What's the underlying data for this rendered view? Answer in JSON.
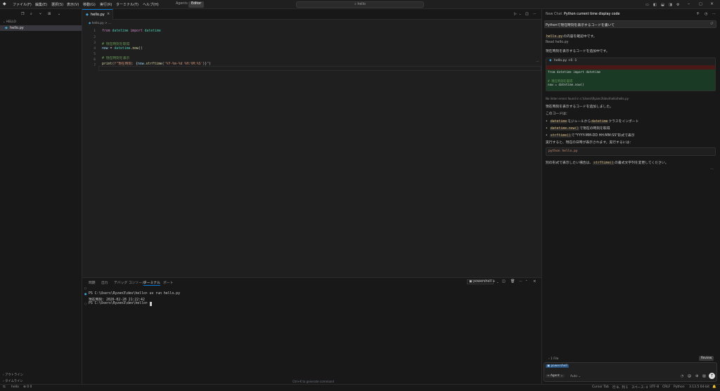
{
  "menu": [
    "ファイル(F)",
    "編集(E)",
    "選択(S)",
    "表示(V)",
    "移動(G)",
    "実行(R)",
    "ターミナル(T)",
    "ヘルプ(H)"
  ],
  "mode_tabs": {
    "agents": "Agents",
    "editor": "Editor"
  },
  "search": {
    "text": "hello"
  },
  "explorer": {
    "folder": "HELLO",
    "file": "hello.py",
    "outline": "アウトライン",
    "timeline": "タイムライン"
  },
  "editor": {
    "tab_label": "hello.py",
    "breadcrumb": "hello.py > ...",
    "line_numbers": [
      "1",
      "2",
      "3",
      "4",
      "5",
      "6",
      "7"
    ]
  },
  "panel": {
    "tabs": [
      "問題",
      "出力",
      "デバッグ コンソール",
      "ターミナル",
      "ポート"
    ],
    "shell": "powershell",
    "lines": [
      "PS C:\\Users\\Ryzen3\\dev\\hello> uv run hello.py",
      "現在時刻: 2026-02-28 21:22:42",
      "PS C:\\Users\\Ryzen3\\dev\\hello> "
    ],
    "hint": "Ctrl+K to generate command"
  },
  "chat": {
    "tabs": {
      "new": "New Chat",
      "current": "Python current time display code"
    },
    "user_prompt": "Pythonで現在時刻を表示するコードを書いて",
    "msg1_code": "hello.py",
    "msg1_text": "の内容を確認中です。",
    "read_label": "Read hello.py",
    "msg2": "現在時刻を表示するコードを追加中です。",
    "diff_header": "hello.py +6 -1",
    "diff_removed": "from datetime import datetime",
    "diff_added_1": "# 現在時刻を取得",
    "diff_added_2": "now = datetime.now()",
    "lint": "No linter errors found in c:\\Users\\Ryzen3\\dev\\hello\\hello.py",
    "msg3": "現在時刻を表示するコードを追加しました。",
    "msg4": "このコードは：",
    "bullets": [
      {
        "code": "datetime",
        "text": "モジュールから",
        "code2": "datetime",
        "text2": "クラスをインポート"
      },
      {
        "code": "datetime.now()",
        "text": "で現在の時刻を取得",
        "code2": "",
        "text2": ""
      },
      {
        "code": "strftime()",
        "text": "で\"YYYY-MM-DD HH:MM:SS\"形式で表示",
        "code2": "",
        "text2": ""
      }
    ],
    "msg5": "実行すると、現在の日時が表示されます。実行するには：",
    "run_cmd": "python hello.py",
    "msg6_a": "別の形式で表示したい場合は、",
    "msg6_code": "strftime()",
    "msg6_b": "の書式文字列を変更してください。",
    "files_changed": "1 File",
    "review": "Review",
    "context_chip": "powershell",
    "agent_label": "Agent",
    "auto_label": "Auto"
  },
  "status": {
    "left": [
      "hello",
      "0  0"
    ],
    "right": [
      "Cursor Tab",
      "行 8、列 1",
      "スペース: 4",
      "UTF-8",
      "CRLF",
      "Python",
      "3.13.5 64-bit"
    ]
  },
  "colors": {
    "accent": "#0078d4",
    "bg": "#181818",
    "editor_bg": "#1f1f1f"
  }
}
